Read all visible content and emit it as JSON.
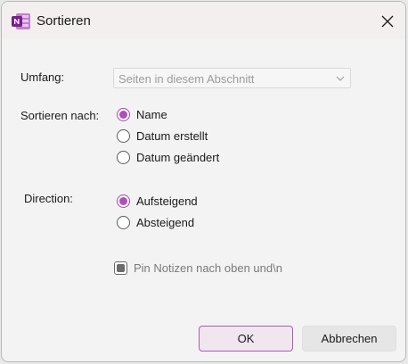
{
  "window": {
    "title": "Sortieren",
    "app_icon": "onenote-icon",
    "close_icon": "close-icon",
    "accent_color": "#b04fb6"
  },
  "scope": {
    "label": "Umfang:",
    "value": "Seiten in diesem Abschnitt",
    "chevron_icon": "chevron-down-icon"
  },
  "sort_by": {
    "label": "Sortieren nach:",
    "options": [
      {
        "label": "Name",
        "checked": true
      },
      {
        "label": "Datum erstellt",
        "checked": false
      },
      {
        "label": "Datum geändert",
        "checked": false
      }
    ]
  },
  "direction": {
    "label": "Direction:",
    "options": [
      {
        "label": "Aufsteigend",
        "checked": true
      },
      {
        "label": "Absteigend",
        "checked": false
      }
    ]
  },
  "pin_checkbox": {
    "label": "Pin Notizen nach oben und\\n",
    "state": "indeterminate"
  },
  "buttons": {
    "ok": "OK",
    "cancel": "Abbrechen"
  }
}
